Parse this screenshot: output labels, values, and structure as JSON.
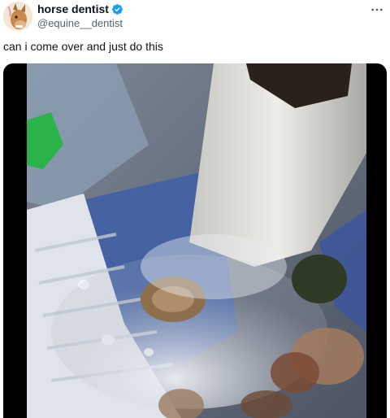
{
  "author": {
    "display_name": "horse dentist",
    "handle": "@equine__dentist",
    "verified": true,
    "avatar_icon": "horse-face-avatar"
  },
  "tweet": {
    "text": "can i come over and just do this"
  },
  "media": {
    "kind": "video",
    "description_icon": "video-frame"
  },
  "icons": {
    "verified_badge": "verified-badge-icon",
    "more": "more-horizontal-icon"
  },
  "colors": {
    "verified_blue": "#1d9bf0",
    "text_primary": "#0f1419",
    "text_secondary": "#536471",
    "media_bg": "#000000"
  }
}
